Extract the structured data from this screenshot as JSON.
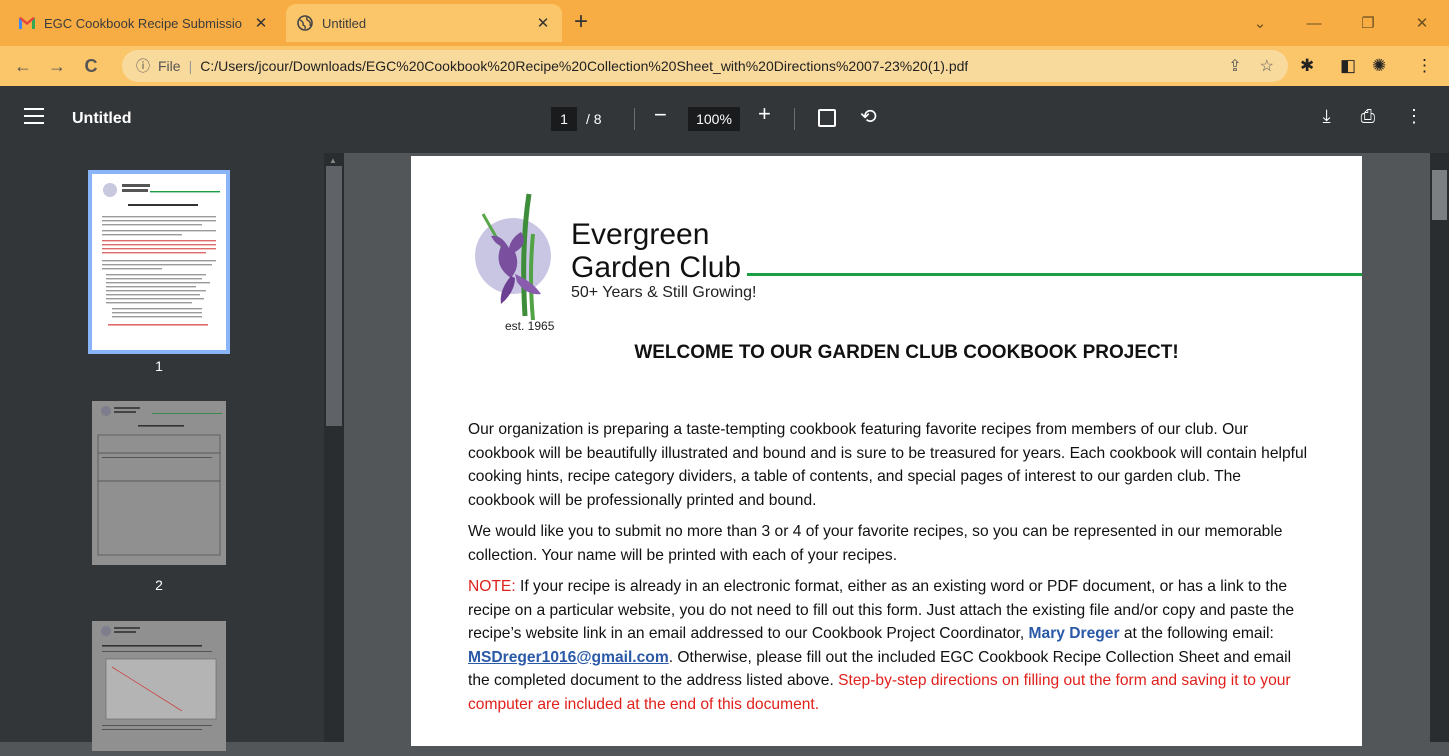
{
  "browser": {
    "tabs": [
      {
        "title": "EGC Cookbook Recipe Submissio",
        "icon": "gmail-icon",
        "active": false
      },
      {
        "title": "Untitled",
        "icon": "globe-icon",
        "active": true
      }
    ],
    "close_glyph": "✕",
    "new_tab_glyph": "+",
    "address": {
      "scheme": "File",
      "url": "C:/Users/jcour/Downloads/EGC%20Cookbook%20Recipe%20Collection%20Sheet_with%20Directions%2007-23%20(1).pdf"
    }
  },
  "viewer": {
    "title": "Untitled",
    "current_page": "1",
    "total_pages": "/  8",
    "zoom": "100%"
  },
  "sidebar": {
    "thumbnails": [
      {
        "number": "1",
        "selected": true
      },
      {
        "number": "2",
        "selected": false
      },
      {
        "number": "",
        "selected": false
      }
    ]
  },
  "document": {
    "club_name_line1": "Evergreen",
    "club_name_line2": "Garden Club",
    "tagline": "50+ Years & Still Growing!",
    "established": "est. 1965",
    "headline": "WELCOME TO OUR GARDEN CLUB COOKBOOK PROJECT!",
    "paragraph1": "Our organization is preparing a taste-tempting cookbook featuring favorite recipes from members of our club. Our cookbook will be beautifully illustrated and bound and is sure to be treasured for years.  Each cookbook will contain helpful cooking hints, recipe category dividers, a table of contents, and special pages of interest to our garden club.  The cookbook will be professionally printed and bound.",
    "paragraph2": "We would like you to submit no more than 3 or 4 of your favorite recipes, so you can be represented in our memorable collection.  Your name will be printed with each of your recipes.",
    "note_label": "NOTE:",
    "note_text_1": " If your recipe is already in an electronic format, either as an existing word or PDF document, or has a link to the recipe on a particular website, you do not need to fill out this form.  Just attach the existing file and/or copy and paste the recipe’s website link in an email addressed to our Cookbook Project Coordinator, ",
    "coordinator_name": "Mary Dreger",
    "note_text_2": " at the following email: ",
    "coordinator_email": "MSDreger1016@gmail.com",
    "note_text_3": ".  Otherwise, please fill out the included EGC Cookbook Recipe Collection Sheet and email the completed document to the address listed above.  ",
    "note_text_red": "Step-by-step directions on filling out the form and saving it to your computer are included at the end of this document."
  },
  "colors": {
    "tabstrip": "#f7ad44",
    "toolbar": "#fbc56a",
    "viewer_bar": "#323639",
    "accent_green": "#1a9f44",
    "note_red": "#e0201b",
    "link_blue": "#2a59a8"
  }
}
